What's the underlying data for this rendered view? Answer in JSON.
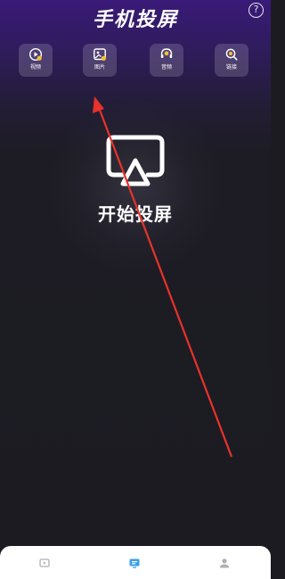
{
  "header": {
    "title": "手机投屏",
    "help_glyph": "?"
  },
  "tools": [
    {
      "label": "视频",
      "icon": "video-icon"
    },
    {
      "label": "图片",
      "icon": "image-icon"
    },
    {
      "label": "音频",
      "icon": "audio-icon"
    },
    {
      "label": "链接",
      "icon": "link-icon"
    }
  ],
  "main": {
    "cast_label": "开始投屏",
    "cast_icon": "screen-cast-icon"
  },
  "tabbar": {
    "items": [
      {
        "icon": "home-icon",
        "active": false
      },
      {
        "icon": "cast-tab-icon",
        "active": true
      },
      {
        "icon": "profile-icon",
        "active": false
      }
    ]
  },
  "colors": {
    "header_purple": "#3a1a78",
    "background": "#1c1b22",
    "accent_yellow": "#f2c230",
    "tab_active": "#3aa0e8",
    "tab_inactive": "#b0b0b0",
    "annotation_arrow": "#e8322a"
  }
}
